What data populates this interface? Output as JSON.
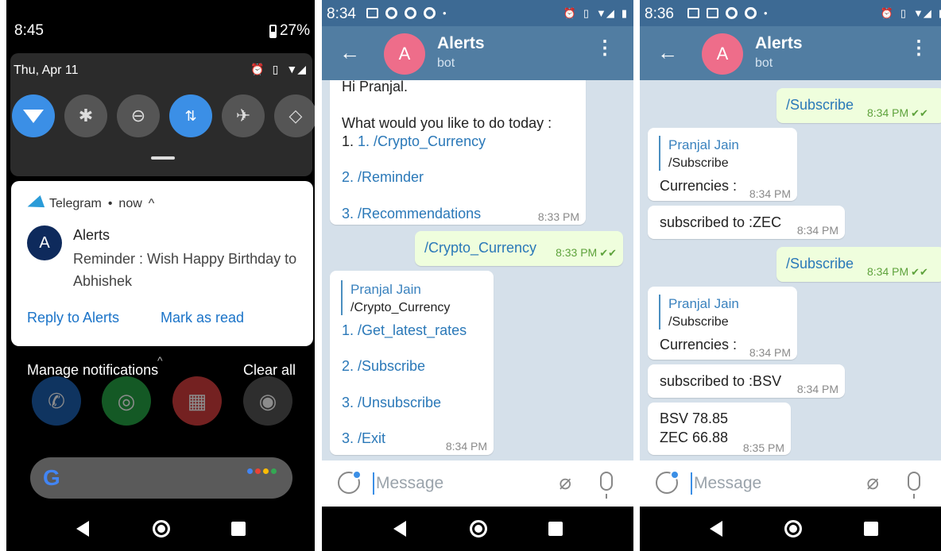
{
  "p1": {
    "time": "8:45",
    "battery": "27%",
    "date": "Thu, Apr 11",
    "notification": {
      "app": "Telegram",
      "when": "now",
      "avatar": "A",
      "title": "Alerts",
      "body": "Reminder : Wish Happy Birthday to Abhishek",
      "actions": [
        "Reply to Alerts",
        "Mark as read"
      ]
    },
    "manage": "Manage notifications",
    "clear": "Clear all",
    "google": "G"
  },
  "p2": {
    "time": "8:34",
    "chat_title": "Alerts",
    "chat_subtitle": "bot",
    "avatar": "A",
    "messages": [
      {
        "type": "in",
        "lines": [
          "Hi Pranjal.",
          "",
          "What would you like to do today :",
          "1. /Crypto_Currency",
          "2. /Reminder",
          "3. /Recommendations"
        ],
        "time": "8:33 PM"
      },
      {
        "type": "out",
        "text": "/Crypto_Currency",
        "time": "8:33 PM"
      },
      {
        "type": "in",
        "quote_name": "Pranjal Jain",
        "quote_text": "/Crypto_Currency",
        "lines": [
          "1. /Get_latest_rates",
          "2. /Subscribe",
          "3. /Unsubscribe",
          "3. /Exit"
        ],
        "time": "8:34 PM"
      }
    ],
    "placeholder": "Message"
  },
  "p3": {
    "time": "8:36",
    "chat_title": "Alerts",
    "chat_subtitle": "bot",
    "avatar": "A",
    "messages": [
      {
        "type": "out",
        "text": "/Subscribe",
        "time": "8:34 PM"
      },
      {
        "type": "in",
        "quote_name": "Pranjal Jain",
        "quote_text": "/Subscribe",
        "text": "Currencies :",
        "time": "8:34 PM"
      },
      {
        "type": "in",
        "text": "subscribed to :ZEC",
        "time": "8:34 PM"
      },
      {
        "type": "out",
        "text": "/Subscribe",
        "time": "8:34 PM"
      },
      {
        "type": "in",
        "quote_name": "Pranjal Jain",
        "quote_text": "/Subscribe",
        "text": "Currencies :",
        "time": "8:34 PM"
      },
      {
        "type": "in",
        "text": "subscribed to :BSV",
        "time": "8:34 PM"
      },
      {
        "type": "in",
        "lines": [
          "BSV  78.85",
          "ZEC  66.88"
        ],
        "time": "8:35 PM"
      }
    ],
    "placeholder": "Message"
  },
  "icons": {
    "wifi": "wifi-icon",
    "bluetooth": "bluetooth-icon",
    "dnd": "dnd-icon",
    "data": "data-icon",
    "airplane": "airplane-icon",
    "rotate": "rotate-icon",
    "alarm": "alarm-icon",
    "vibrate": "vibrate-icon"
  },
  "colors": {
    "telegram_header": "#517da2",
    "telegram_status": "#3d6a94",
    "chat_bg": "#d5e0ea",
    "out_bubble": "#effedd",
    "link": "#2a78b8",
    "tile_on": "#3b8fe6"
  }
}
